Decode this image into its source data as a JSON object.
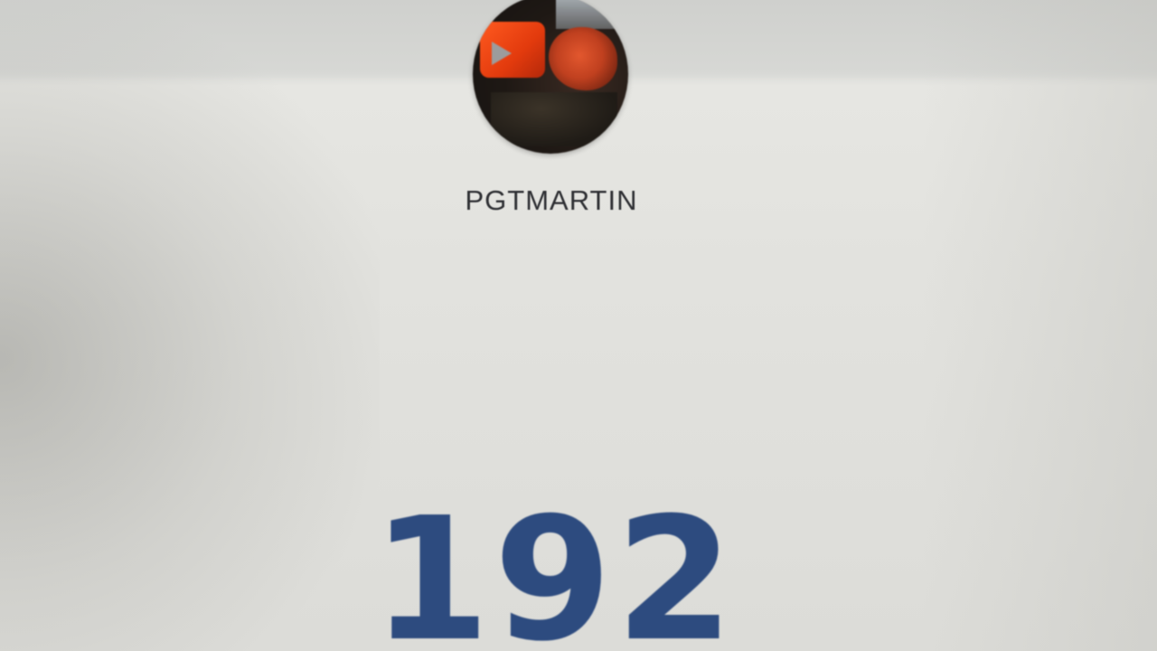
{
  "profile": {
    "avatar_icon": "channel-avatar-play-icon",
    "username": "PGTMARTIN",
    "count": "192"
  },
  "colors": {
    "count_text": "#2d4b7f",
    "username_text": "#2e2f33",
    "avatar_accent": "#e23a0d"
  }
}
